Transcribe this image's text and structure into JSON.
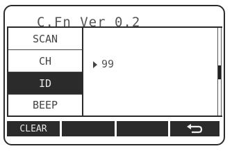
{
  "header": {
    "title": "C.Fn Ver 0.2"
  },
  "menu": {
    "items": [
      {
        "label": "SCAN",
        "selected": false
      },
      {
        "label": "CH",
        "selected": false
      },
      {
        "label": "ID",
        "selected": true
      },
      {
        "label": "BEEP",
        "selected": false
      }
    ]
  },
  "content": {
    "value": "99",
    "indicator_icon": "triangle-right-icon"
  },
  "softkeys": {
    "key1": "CLEAR",
    "key2": "",
    "key3": "",
    "key4_icon": "return-icon"
  },
  "scrollbar": {
    "position": 0.45
  }
}
